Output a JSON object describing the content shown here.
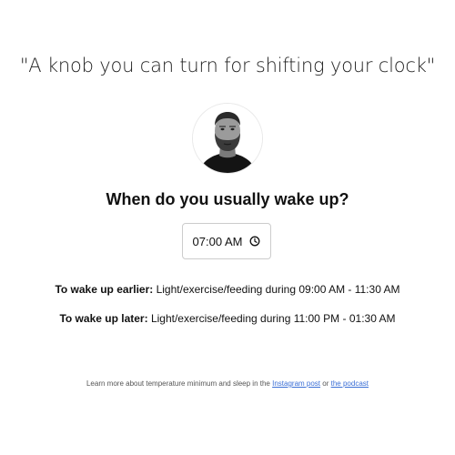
{
  "quote": "\"A knob you can turn for shifting your clock\"",
  "question": "When do you usually wake up?",
  "time_input": {
    "value": "07:00 AM",
    "icon": "clock-icon"
  },
  "earlier": {
    "label": "To wake up earlier:",
    "text": "Light/exercise/feeding during 09:00 AM - 11:30 AM"
  },
  "later": {
    "label": "To wake up later:",
    "text": "Light/exercise/feeding during 11:00 PM - 01:30 AM"
  },
  "footer": {
    "text_before": "Learn more about temperature minimum and sleep in the",
    "instagram_link": "Instagram post",
    "or_text": "or",
    "podcast_link": "the podcast"
  },
  "colors": {
    "link": "#3b6fd6",
    "text": "#111111",
    "input_border": "#cccccc"
  },
  "avatar": {
    "icon": "portrait-photo"
  }
}
